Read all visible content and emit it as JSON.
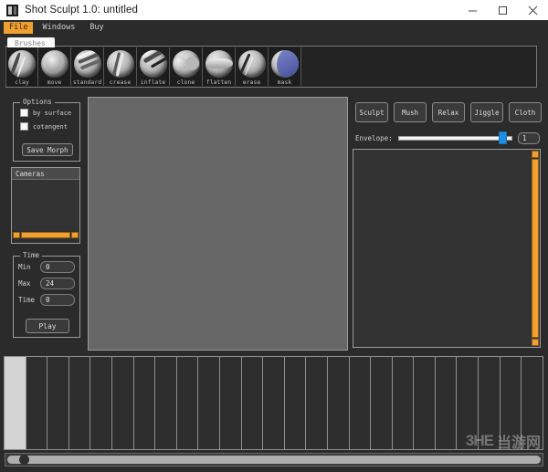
{
  "window": {
    "title": "Shot Sculpt 1.0: untitled",
    "icon": "app-icon",
    "controls": [
      {
        "name": "minimize",
        "glyph": "minimize-icon"
      },
      {
        "name": "maximize",
        "glyph": "maximize-icon"
      },
      {
        "name": "close",
        "glyph": "close-icon"
      }
    ]
  },
  "menubar": {
    "items": [
      {
        "label": "File",
        "active": true
      },
      {
        "label": "Windows",
        "active": false
      },
      {
        "label": "Buy",
        "active": false
      }
    ]
  },
  "brushes": {
    "tab_label": "Brushes",
    "items": [
      {
        "label": "clay",
        "icon": "clay-brush-icon"
      },
      {
        "label": "move",
        "icon": "move-brush-icon"
      },
      {
        "label": "standard",
        "icon": "standard-brush-icon"
      },
      {
        "label": "crease",
        "icon": "crease-brush-icon"
      },
      {
        "label": "inflate",
        "icon": "inflate-brush-icon"
      },
      {
        "label": "clone",
        "icon": "clone-brush-icon"
      },
      {
        "label": "flatten",
        "icon": "flatten-brush-icon"
      },
      {
        "label": "erase",
        "icon": "erase-brush-icon"
      },
      {
        "label": "mask",
        "icon": "mask-brush-icon"
      }
    ]
  },
  "options": {
    "title": "Options",
    "by_surface": {
      "label": "by surface",
      "checked": false
    },
    "cotangent": {
      "label": "cotangent",
      "checked": false
    },
    "save_morph_label": "Save Morph"
  },
  "cameras": {
    "title": "Cameras",
    "items": []
  },
  "time": {
    "title": "Time",
    "min_label": "Min",
    "min_value": "0",
    "max_label": "Max",
    "max_value": "24",
    "time_label": "Time",
    "time_value": "0",
    "play_label": "Play"
  },
  "modes": {
    "buttons": [
      {
        "label": "Sculpt"
      },
      {
        "label": "Mush"
      },
      {
        "label": "Relax"
      },
      {
        "label": "Jiggle"
      },
      {
        "label": "Cloth"
      }
    ]
  },
  "envelope": {
    "label": "Envelope:",
    "value": "1",
    "percent": 92
  },
  "timeline": {
    "cell_count": 25,
    "current_frame": 0
  },
  "timeline_scroll": {
    "position_percent": 2
  },
  "watermark": {
    "mark": "3HE",
    "text": "当游网"
  },
  "colors": {
    "accent_orange": "#f0a030",
    "slider_blue": "#1e8fe0",
    "panel_bg": "#2b2b2b",
    "viewport_gray": "#676767",
    "titlebar": "#ffffff"
  }
}
